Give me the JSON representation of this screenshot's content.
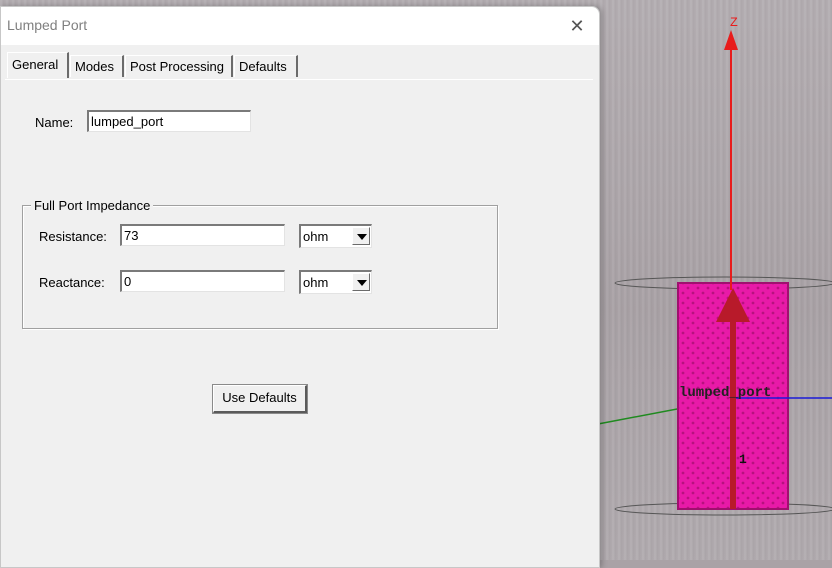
{
  "viewport": {
    "axis_label": "Z",
    "port_label": "lumped_port",
    "port_number": "1",
    "colors": {
      "axis_red": "#e81c1c",
      "port_magenta": "#e81aa8",
      "axis_green": "#1f8a1f",
      "axis_blue": "#1b1bd8"
    }
  },
  "dialog": {
    "title": "Lumped Port",
    "close_glyph": "✕",
    "tabs": [
      {
        "label": "General",
        "active": true
      },
      {
        "label": "Modes",
        "active": false
      },
      {
        "label": "Post Processing",
        "active": false
      },
      {
        "label": "Defaults",
        "active": false
      }
    ],
    "name": {
      "label": "Name:",
      "value": "lumped_port"
    },
    "impedance": {
      "group_title": "Full Port Impedance",
      "resistance": {
        "label": "Resistance:",
        "value": "73",
        "unit": "ohm"
      },
      "reactance": {
        "label": "Reactance:",
        "value": "0",
        "unit": "ohm"
      }
    },
    "use_defaults_label": "Use Defaults"
  }
}
